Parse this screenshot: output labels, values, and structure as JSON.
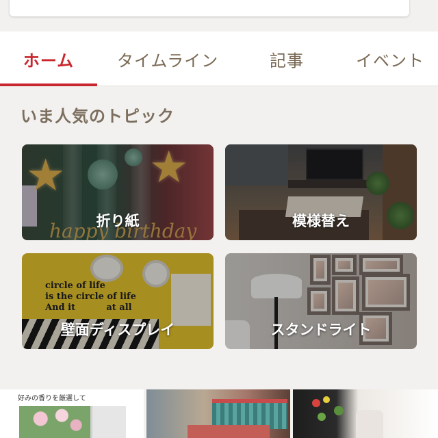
{
  "tabs": [
    {
      "label": "ホーム",
      "active": true
    },
    {
      "label": "タイムライン",
      "active": false
    },
    {
      "label": "記事",
      "active": false
    },
    {
      "label": "イベント",
      "active": false
    }
  ],
  "section": {
    "title": "いま人気のトピック",
    "topics": [
      {
        "label": "折り紙"
      },
      {
        "label": "模様替え"
      },
      {
        "label": "壁面ディスプレイ"
      },
      {
        "label": "スタンドライト"
      }
    ]
  },
  "feed": {
    "first_caption": "好みの香りを厳選して"
  },
  "colors": {
    "accent": "#c8262d",
    "tab_text": "#7a6a55",
    "section_title": "#7d6f5f",
    "background": "#f2f1ef"
  }
}
